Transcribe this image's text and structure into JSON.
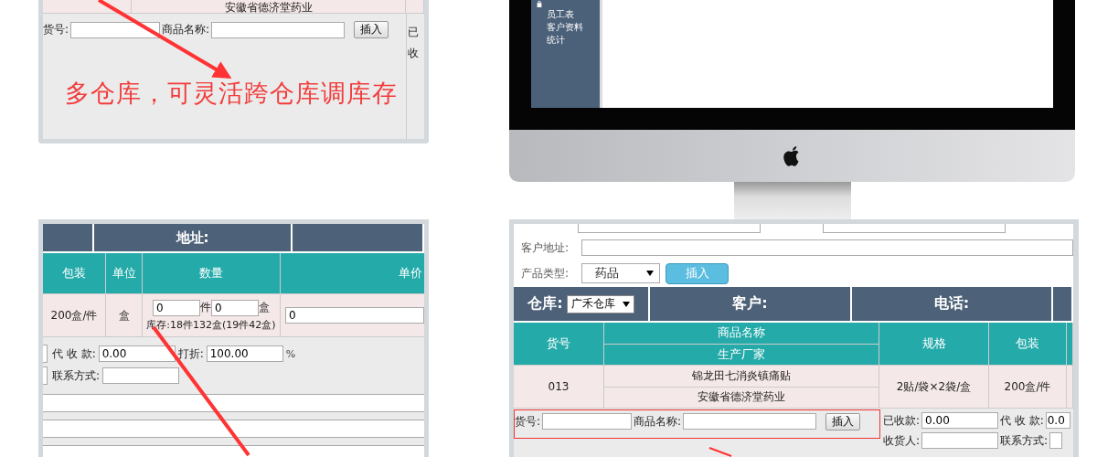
{
  "order_panel_top": {
    "manufacturer": "安徽省德济堂药业",
    "item_no_label": "货号:",
    "product_name_label": "商品名称:",
    "insert_button": "插入",
    "side_labels": [
      "已",
      "收"
    ],
    "caption": "多仓库，可灵活跨仓库调库存"
  },
  "monitor": {
    "sidebar_items": [
      "员工表",
      "客户资料",
      "统计"
    ]
  },
  "order_panel_left": {
    "header": "地址:",
    "columns": [
      "包装",
      "单位",
      "数量",
      "单价"
    ],
    "row": {
      "packing": "200盒/件",
      "unit": "盒",
      "pieces": "0",
      "pieces_unit": "件",
      "boxes": "0",
      "boxes_unit": "盒",
      "stock": "库存:18件132盒(19件42盒)",
      "price": "0"
    },
    "fields": [
      {
        "label": "代 收 款:",
        "value": "0.00"
      },
      {
        "label": "打折:",
        "value": "100.00",
        "suffix": "%"
      }
    ],
    "contact_label": "联系方式:"
  },
  "order_panel_right": {
    "address_label": "客户地址:",
    "type_label": "产品类型:",
    "type_value": "药品",
    "type_button": "插入",
    "warehouse_label": "仓库:",
    "warehouse_value": "广禾仓库",
    "customer_label": "客户:",
    "phone_label": "电话:",
    "columns": {
      "item_no": "货号",
      "product_name": "商品名称",
      "manufacturer": "生产厂家",
      "spec": "规格",
      "packing": "包装"
    },
    "row": {
      "item_no": "013",
      "product_name": "锦龙田七消炎镇痛贴",
      "manufacturer": "安徽省德济堂药业",
      "spec": "2贴/袋×2袋/盒",
      "packing": "200盒/件"
    },
    "item_no_label": "货号:",
    "product_name_label": "商品名称:",
    "insert_button": "插入",
    "received_label": "已收款:",
    "received_value": "0.00",
    "collect_label": "代 收 款:",
    "collect_value": "0.0",
    "consignee_label": "收货人:",
    "contact_label": "联系方式:"
  }
}
